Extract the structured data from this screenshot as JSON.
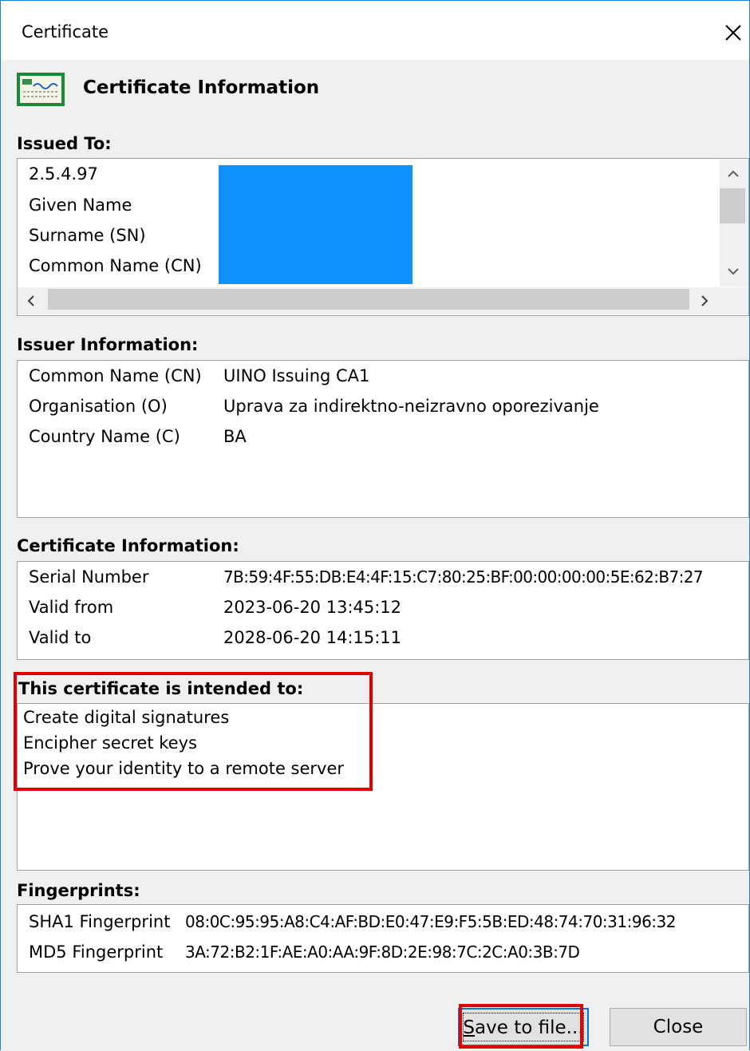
{
  "window": {
    "title": "Certificate"
  },
  "header": {
    "title": "Certificate Information",
    "icon": "certificate-icon"
  },
  "issued_to": {
    "label": "Issued To:",
    "rows": [
      "2.5.4.97",
      "Given Name",
      "Surname (SN)",
      "Common Name (CN)"
    ]
  },
  "issuer": {
    "label": "Issuer Information:",
    "rows": [
      {
        "field": "Common Name (CN)",
        "value": "UINO Issuing CA1"
      },
      {
        "field": "Organisation (O)",
        "value": "Uprava za indirektno-neizravno oporezivanje"
      },
      {
        "field": "Country Name (C)",
        "value": "BA"
      }
    ]
  },
  "cert_info": {
    "label": "Certificate Information:",
    "rows": [
      {
        "field": "Serial Number",
        "value": "7B:59:4F:55:DB:E4:4F:15:C7:80:25:BF:00:00:00:00:5E:62:B7:27"
      },
      {
        "field": "Valid from",
        "value": "2023-06-20 13:45:12"
      },
      {
        "field": "Valid to",
        "value": "2028-06-20 14:15:11"
      }
    ]
  },
  "intended": {
    "label": "This certificate is intended to:",
    "items": [
      "Create digital signatures",
      "Encipher secret keys",
      "Prove your identity to a remote server"
    ]
  },
  "fingerprints": {
    "label": "Fingerprints:",
    "rows": [
      {
        "field": "SHA1 Fingerprint",
        "value": "08:0C:95:95:A8:C4:AF:BD:E0:47:E9:F5:5B:ED:48:74:70:31:96:32"
      },
      {
        "field": "MD5 Fingerprint",
        "value": "3A:72:B2:1F:AE:A0:AA:9F:8D:2E:98:7C:2C:A0:3B:7D"
      }
    ]
  },
  "buttons": {
    "save_pre": "",
    "save_key": "S",
    "save_rest": "ave to file...",
    "close": "Close"
  },
  "colors": {
    "accent": "#0078d7",
    "highlight_frame": "#e10000",
    "redaction": "#0f91fb"
  }
}
